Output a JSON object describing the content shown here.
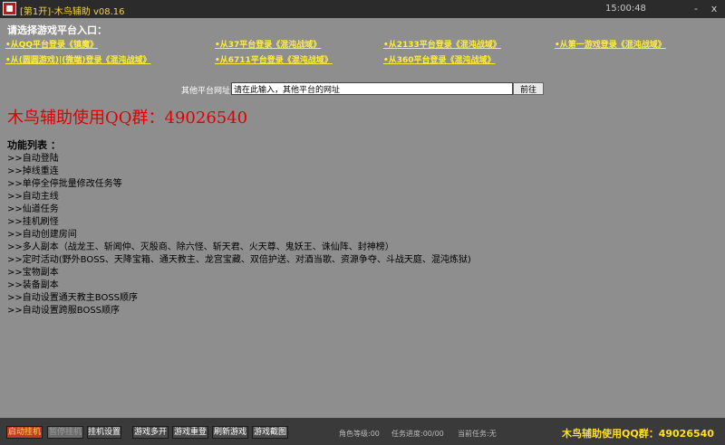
{
  "window": {
    "title": "[第1开]-木鸟辅助  v08.16",
    "time": "15:00:48",
    "controls": [
      "-",
      "x"
    ]
  },
  "header": {
    "prompt": "请选择游戏平台入口："
  },
  "platforms": [
    "•从QQ平台登录《镇魔》",
    "•从37平台登录《混沌战域》",
    "•从2133平台登录《混沌战域》",
    "•从第一游戏登录《混沌战域》",
    "•从(圆圆游戏)|(微端)登录《混沌战域》",
    "•从6711平台登录《混沌战域》",
    "•从360平台登录《混沌战域》"
  ],
  "other_platform": {
    "label": "其他平台网址：",
    "input_value": "请在此输入，其他平台的网址",
    "go_label": "前往"
  },
  "banner": "木鸟辅助使用QQ群：49026540",
  "features": {
    "title": "功能列表 ：",
    "items": [
      ">>自动登陆",
      ">>掉线重连",
      ">>单停全停批量修改任务等",
      ">>自动主线",
      ">>仙道任务",
      ">>挂机刷怪",
      ">>自动创建房间",
      ">>多人副本（战龙王、斩闻仲、灭殷商、除六怪、斩天君、火天尊、鬼妖王、诛仙阵、封神榜）",
      ">>定时活动(野外BOSS、天降宝箱、通天教主、龙宫宝藏、双倍护送、对酒当歌、资源争夺、斗战天庭、混沌炼狱)",
      ">>宝物副本",
      ">>装备副本",
      ">>自动设置通天教主BOSS顺序",
      ">>自动设置跨服BOSS顺序"
    ]
  },
  "bottom": {
    "buttons": [
      "启动挂机",
      "暂停挂机",
      "挂机设置",
      "游戏多开",
      "游戏重登",
      "刷新游戏",
      "游戏截图"
    ],
    "role_level": "角色等级:00",
    "task_progress": "任务进度:00/00",
    "current_task": "当前任务:无",
    "qq": "木鸟辅助使用QQ群：49026540"
  }
}
